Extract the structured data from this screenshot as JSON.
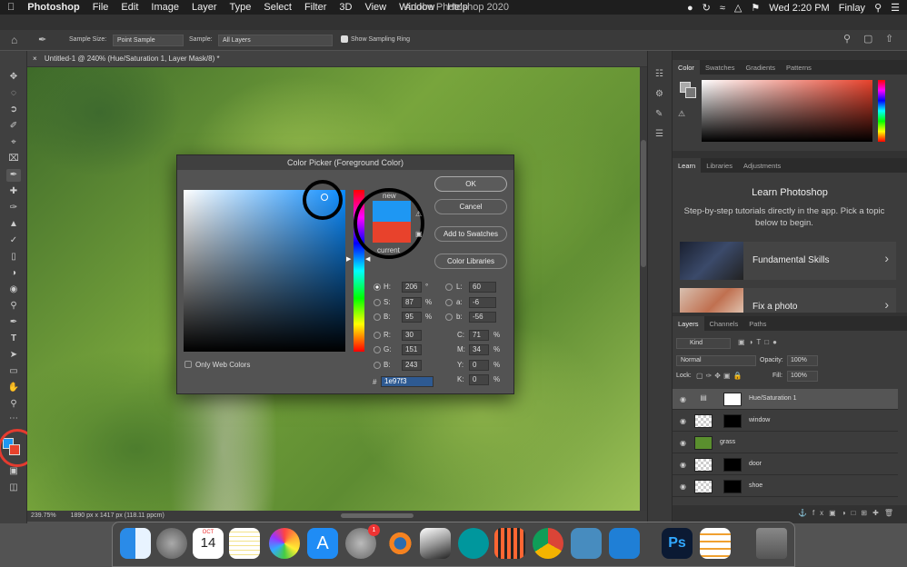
{
  "menubar": {
    "app": "Photoshop",
    "items": [
      "File",
      "Edit",
      "Image",
      "Layer",
      "Type",
      "Select",
      "Filter",
      "3D",
      "View",
      "Window",
      "Help"
    ],
    "title": "Adobe Photoshop 2020",
    "clock": "Wed 2:20 PM",
    "user": "Finlay"
  },
  "options": {
    "sample_size_label": "Sample Size:",
    "sample_size_value": "Point Sample",
    "sample_label": "Sample:",
    "sample_value": "All Layers",
    "sampling_ring": "Show Sampling Ring"
  },
  "document": {
    "tab": "Untitled-1 @ 240% (Hue/Saturation 1, Layer Mask/8) *",
    "zoom": "239.75%",
    "info": "1890 px x 1417 px (118.11 ppcm)"
  },
  "dialog": {
    "title": "Color Picker (Foreground Color)",
    "ok": "OK",
    "cancel": "Cancel",
    "add_swatches": "Add to Swatches",
    "color_libraries": "Color Libraries",
    "new_label": "new",
    "current_label": "current",
    "only_web": "Only Web Colors",
    "new_color": "#1e97f3",
    "current_color": "#e8422c",
    "fields": {
      "H": "206",
      "S": "87",
      "B": "95",
      "R": "30",
      "G": "151",
      "Bb": "243",
      "L": "60",
      "a": "-6",
      "b": "-56",
      "C": "71",
      "M": "34",
      "Y": "0",
      "K": "0"
    },
    "units": {
      "deg": "°",
      "pct": "%"
    },
    "hex_label": "#",
    "hex": "1e97f3"
  },
  "panels": {
    "color_tabs": [
      "Color",
      "Swatches",
      "Gradients",
      "Patterns"
    ],
    "learn_tabs": [
      "Learn",
      "Libraries",
      "Adjustments"
    ],
    "learn_title": "Learn Photoshop",
    "learn_desc": "Step-by-step tutorials directly in the app. Pick a topic below to begin.",
    "tutorials": [
      "Fundamental Skills",
      "Fix a photo"
    ],
    "layers_tabs": [
      "Layers",
      "Channels",
      "Paths"
    ],
    "kind": "Kind",
    "blend": "Normal",
    "opacity_label": "Opacity:",
    "opacity": "100%",
    "lock_label": "Lock:",
    "fill_label": "Fill:",
    "fill": "100%",
    "layers": [
      "Hue/Saturation 1",
      "window",
      "grass",
      "door",
      "shoe"
    ]
  },
  "dock": {
    "calendar_month": "OCT",
    "calendar_day": "14",
    "badge": "1"
  }
}
